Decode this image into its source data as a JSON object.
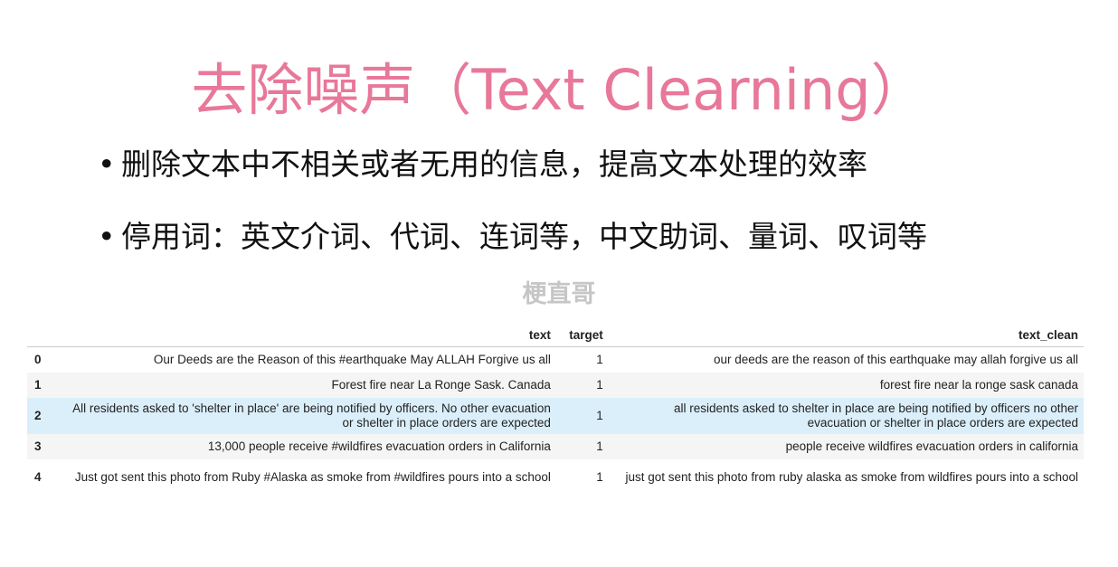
{
  "slide": {
    "title": "去除噪声（Text Clearning）",
    "bullets": [
      "删除文本中不相关或者无用的信息，提高文本处理的效率",
      "停用词：英文介词、代词、连词等，中文助词、量词、叹词等"
    ],
    "watermark": "梗直哥"
  },
  "table": {
    "columns": [
      "",
      "text",
      "target",
      "text_clean"
    ],
    "rows": [
      {
        "index": "0",
        "text": "Our Deeds are the Reason of this #earthquake May ALLAH Forgive us all",
        "target": "1",
        "text_clean": "our deeds are the reason of this earthquake may allah forgive us all"
      },
      {
        "index": "1",
        "text": "Forest fire near La Ronge Sask. Canada",
        "target": "1",
        "text_clean": "forest fire near la ronge sask canada"
      },
      {
        "index": "2",
        "text": "All residents asked to 'shelter in place' are being notified by officers. No other evacuation or shelter in place orders are expected",
        "target": "1",
        "text_clean": "all residents asked to shelter in place are being notified by officers no other evacuation or shelter in place orders are expected"
      },
      {
        "index": "3",
        "text": "13,000 people receive #wildfires evacuation orders in California",
        "target": "1",
        "text_clean": "people receive wildfires evacuation orders in california"
      },
      {
        "index": "4",
        "text": "Just got sent this photo from Ruby #Alaska as smoke from #wildfires pours into a school",
        "target": "1",
        "text_clean": "just got sent this photo from ruby alaska as smoke from wildfires pours into a school"
      }
    ]
  },
  "colors": {
    "title": "#e8789a",
    "row_stripe": "#f5f5f5",
    "row_highlight": "#dbeffa",
    "watermark": "#c6c6c6"
  }
}
